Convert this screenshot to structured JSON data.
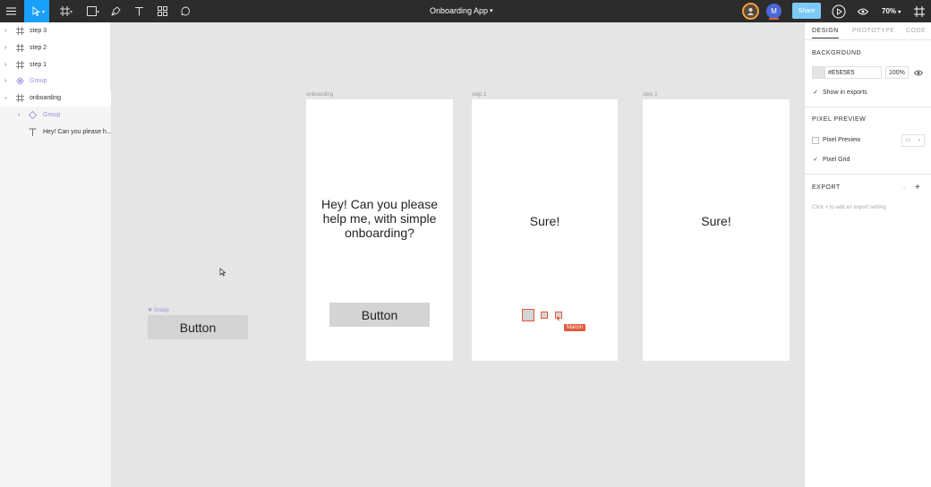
{
  "toolbar": {
    "title": "Onboarding App",
    "share_label": "Share",
    "zoom": "70%",
    "avatar_initial": "M"
  },
  "layers": [
    {
      "label": "step 3",
      "type": "frame"
    },
    {
      "label": "step 2",
      "type": "frame"
    },
    {
      "label": "step 1",
      "type": "frame"
    },
    {
      "label": "Group",
      "type": "component"
    },
    {
      "label": "onboarding",
      "type": "frame",
      "expanded": true
    },
    {
      "label": "Group",
      "type": "component-instance"
    },
    {
      "label": "Hey! Can you please h...",
      "type": "text"
    }
  ],
  "canvas": {
    "group_tag": "❖ Group",
    "group_button_label": "Button",
    "frames": [
      {
        "label": "onboarding",
        "text": "Hey! Can you please help me, with simple onboarding?",
        "button_label": "Button"
      },
      {
        "label": "step 1",
        "text": "Sure!"
      },
      {
        "label": "step 2",
        "text": "Sure!"
      }
    ],
    "cursor_user": "Marcin"
  },
  "props": {
    "tabs": [
      "DESIGN",
      "PROTOTYPE",
      "CODE"
    ],
    "background_heading": "BACKGROUND",
    "background_hex": "#E5E5E5",
    "background_opacity": "100%",
    "show_in_exports_label": "Show in exports",
    "pixel_preview_heading": "PIXEL PREVIEW",
    "pixel_preview_label": "Pixel Preview",
    "pixel_preview_scale": "1x",
    "pixel_grid_label": "Pixel Grid",
    "export_heading": "EXPORT",
    "export_hint": "Click + to add an export setting"
  },
  "colors": {
    "accent": "#18a0fb",
    "toolbar_bg": "#2c2c2c",
    "canvas_bg": "#e5e5e5",
    "multiplayer": "#e05a3a",
    "component": "#9e8ae0"
  }
}
